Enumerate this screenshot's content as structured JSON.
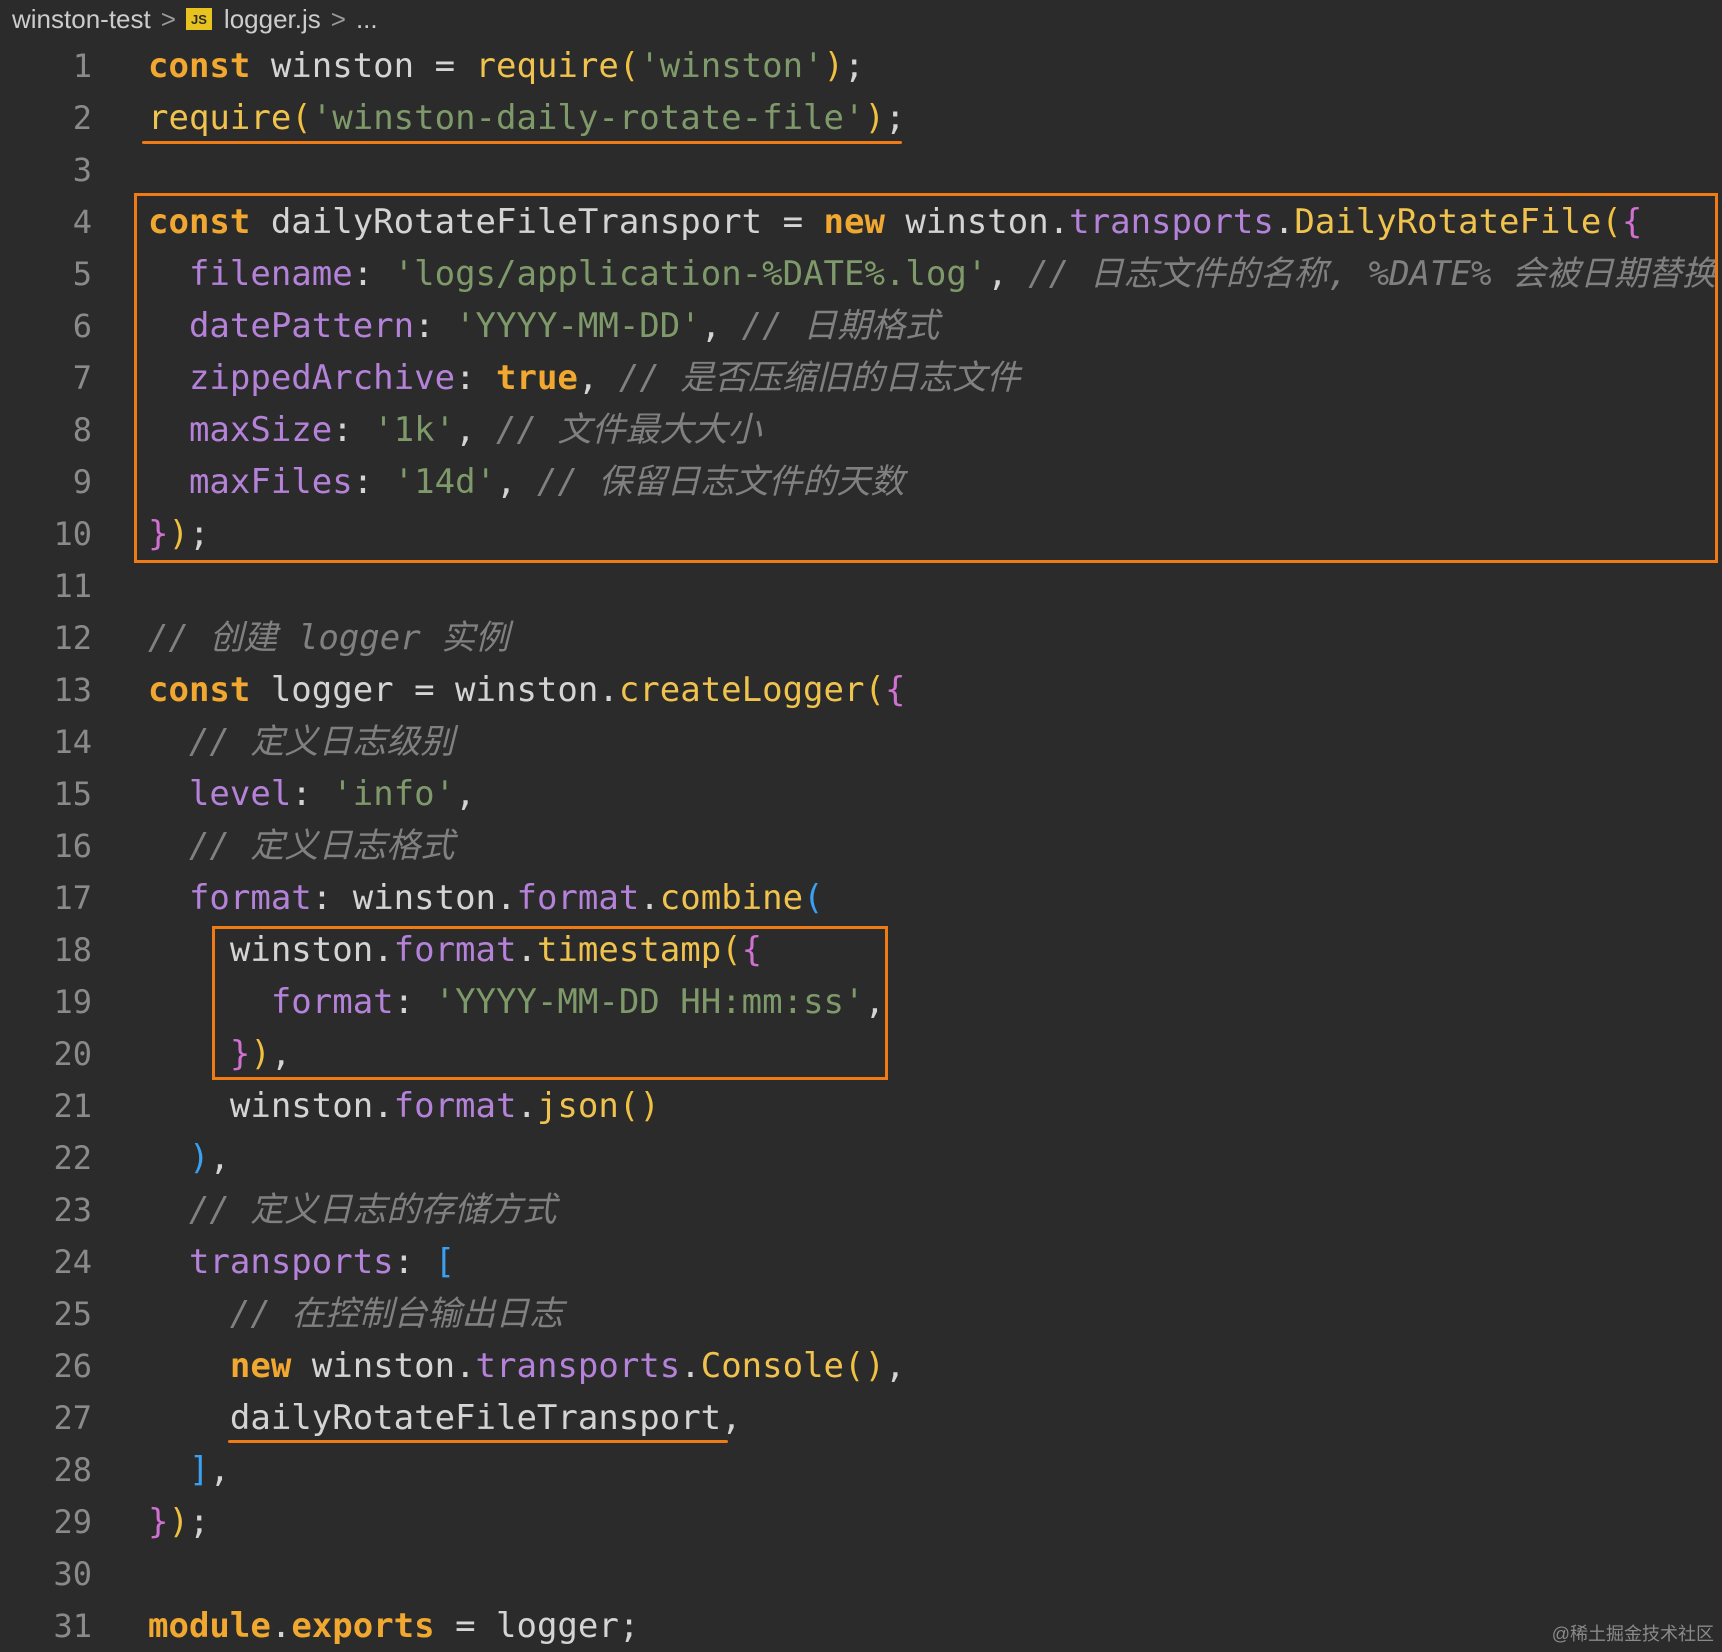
{
  "breadcrumb": {
    "folder": "winston-test",
    "separator": ">",
    "file_icon": "js-file-icon",
    "file_icon_label": "JS",
    "file": "logger.js",
    "trail": "..."
  },
  "colors": {
    "background": "#2b2b2b",
    "keyword": "#f0a830",
    "string": "#7f9a6a",
    "property": "#b482d8",
    "function": "#f0c34e",
    "comment": "#808080",
    "annotation": "#f07a14"
  },
  "lines": [
    {
      "n": "1",
      "tokens": [
        [
          "k",
          "const"
        ],
        [
          "id",
          " winston = "
        ],
        [
          "fn",
          "require"
        ],
        [
          "y",
          "("
        ],
        [
          "str",
          "'winston'"
        ],
        [
          "y",
          ")"
        ],
        [
          "p",
          ";"
        ]
      ]
    },
    {
      "n": "2",
      "tokens": [
        [
          "fn",
          "require"
        ],
        [
          "y",
          "("
        ],
        [
          "str",
          "'winston-daily-rotate-file'"
        ],
        [
          "y",
          ")"
        ],
        [
          "p",
          ";"
        ]
      ]
    },
    {
      "n": "3",
      "tokens": []
    },
    {
      "n": "4",
      "tokens": [
        [
          "k",
          "const"
        ],
        [
          "id",
          " dailyRotateFileTransport = "
        ],
        [
          "k",
          "new"
        ],
        [
          "id",
          " winston."
        ],
        [
          "prop",
          "transports"
        ],
        [
          "id",
          "."
        ],
        [
          "fn",
          "DailyRotateFile"
        ],
        [
          "y",
          "("
        ],
        [
          "m",
          "{"
        ]
      ]
    },
    {
      "n": "5",
      "tokens": [
        [
          "id",
          "  "
        ],
        [
          "prop",
          "filename"
        ],
        [
          "p",
          ": "
        ],
        [
          "str",
          "'logs/application-%DATE%.log'"
        ],
        [
          "p",
          ", "
        ],
        [
          "cm",
          "// 日志文件的名称, %DATE% 会被日期替换"
        ]
      ]
    },
    {
      "n": "6",
      "tokens": [
        [
          "id",
          "  "
        ],
        [
          "prop",
          "datePattern"
        ],
        [
          "p",
          ": "
        ],
        [
          "str",
          "'YYYY-MM-DD'"
        ],
        [
          "p",
          ", "
        ],
        [
          "cm",
          "// 日期格式"
        ]
      ]
    },
    {
      "n": "7",
      "tokens": [
        [
          "id",
          "  "
        ],
        [
          "prop",
          "zippedArchive"
        ],
        [
          "p",
          ": "
        ],
        [
          "k",
          "true"
        ],
        [
          "p",
          ", "
        ],
        [
          "cm",
          "// 是否压缩旧的日志文件"
        ]
      ]
    },
    {
      "n": "8",
      "tokens": [
        [
          "id",
          "  "
        ],
        [
          "prop",
          "maxSize"
        ],
        [
          "p",
          ": "
        ],
        [
          "str",
          "'1k'"
        ],
        [
          "p",
          ", "
        ],
        [
          "cm",
          "// 文件最大大小"
        ]
      ]
    },
    {
      "n": "9",
      "tokens": [
        [
          "id",
          "  "
        ],
        [
          "prop",
          "maxFiles"
        ],
        [
          "p",
          ": "
        ],
        [
          "str",
          "'14d'"
        ],
        [
          "p",
          ", "
        ],
        [
          "cm",
          "// 保留日志文件的天数"
        ]
      ]
    },
    {
      "n": "10",
      "tokens": [
        [
          "m",
          "}"
        ],
        [
          "y",
          ")"
        ],
        [
          "p",
          ";"
        ]
      ]
    },
    {
      "n": "11",
      "tokens": []
    },
    {
      "n": "12",
      "tokens": [
        [
          "cm",
          "// 创建 logger 实例"
        ]
      ]
    },
    {
      "n": "13",
      "tokens": [
        [
          "k",
          "const"
        ],
        [
          "id",
          " logger = winston."
        ],
        [
          "fn",
          "createLogger"
        ],
        [
          "y",
          "("
        ],
        [
          "m",
          "{"
        ]
      ]
    },
    {
      "n": "14",
      "tokens": [
        [
          "id",
          "  "
        ],
        [
          "cm",
          "// 定义日志级别"
        ]
      ]
    },
    {
      "n": "15",
      "tokens": [
        [
          "id",
          "  "
        ],
        [
          "prop",
          "level"
        ],
        [
          "p",
          ": "
        ],
        [
          "str",
          "'info'"
        ],
        [
          "p",
          ","
        ]
      ]
    },
    {
      "n": "16",
      "tokens": [
        [
          "id",
          "  "
        ],
        [
          "cm",
          "// 定义日志格式"
        ]
      ]
    },
    {
      "n": "17",
      "tokens": [
        [
          "id",
          "  "
        ],
        [
          "prop",
          "format"
        ],
        [
          "p",
          ": winston."
        ],
        [
          "prop",
          "format"
        ],
        [
          "p",
          "."
        ],
        [
          "fn",
          "combine"
        ],
        [
          "b",
          "("
        ]
      ]
    },
    {
      "n": "18",
      "tokens": [
        [
          "id",
          "    winston."
        ],
        [
          "prop",
          "format"
        ],
        [
          "p",
          "."
        ],
        [
          "fn",
          "timestamp"
        ],
        [
          "y",
          "("
        ],
        [
          "m",
          "{"
        ]
      ]
    },
    {
      "n": "19",
      "tokens": [
        [
          "id",
          "      "
        ],
        [
          "prop",
          "format"
        ],
        [
          "p",
          ": "
        ],
        [
          "str",
          "'YYYY-MM-DD HH:mm:ss'"
        ],
        [
          "p",
          ","
        ]
      ]
    },
    {
      "n": "20",
      "tokens": [
        [
          "id",
          "    "
        ],
        [
          "m",
          "}"
        ],
        [
          "y",
          ")"
        ],
        [
          "p",
          ","
        ]
      ]
    },
    {
      "n": "21",
      "tokens": [
        [
          "id",
          "    winston."
        ],
        [
          "prop",
          "format"
        ],
        [
          "p",
          "."
        ],
        [
          "fn",
          "json"
        ],
        [
          "y",
          "()"
        ]
      ]
    },
    {
      "n": "22",
      "tokens": [
        [
          "id",
          "  "
        ],
        [
          "b",
          ")"
        ],
        [
          "p",
          ","
        ]
      ]
    },
    {
      "n": "23",
      "tokens": [
        [
          "id",
          "  "
        ],
        [
          "cm",
          "// 定义日志的存储方式"
        ]
      ]
    },
    {
      "n": "24",
      "tokens": [
        [
          "id",
          "  "
        ],
        [
          "prop",
          "transports"
        ],
        [
          "p",
          ": "
        ],
        [
          "b",
          "["
        ]
      ]
    },
    {
      "n": "25",
      "tokens": [
        [
          "id",
          "    "
        ],
        [
          "cm",
          "// 在控制台输出日志"
        ]
      ]
    },
    {
      "n": "26",
      "tokens": [
        [
          "id",
          "    "
        ],
        [
          "k",
          "new"
        ],
        [
          "id",
          " winston."
        ],
        [
          "prop",
          "transports"
        ],
        [
          "p",
          "."
        ],
        [
          "fn",
          "Console"
        ],
        [
          "y",
          "()"
        ],
        [
          "p",
          ","
        ]
      ]
    },
    {
      "n": "27",
      "tokens": [
        [
          "id",
          "    dailyRotateFileTransport"
        ],
        [
          "p",
          ","
        ]
      ]
    },
    {
      "n": "28",
      "tokens": [
        [
          "id",
          "  "
        ],
        [
          "b",
          "]"
        ],
        [
          "p",
          ","
        ]
      ]
    },
    {
      "n": "29",
      "tokens": [
        [
          "m",
          "}"
        ],
        [
          "y",
          ")"
        ],
        [
          "p",
          ";"
        ]
      ]
    },
    {
      "n": "30",
      "tokens": []
    },
    {
      "n": "31",
      "tokens": [
        [
          "k",
          "module"
        ],
        [
          "p",
          "."
        ],
        [
          "k",
          "exports"
        ],
        [
          "id",
          " = logger"
        ],
        [
          "p",
          ";"
        ]
      ]
    }
  ],
  "watermark": "@稀土掘金技术社区"
}
